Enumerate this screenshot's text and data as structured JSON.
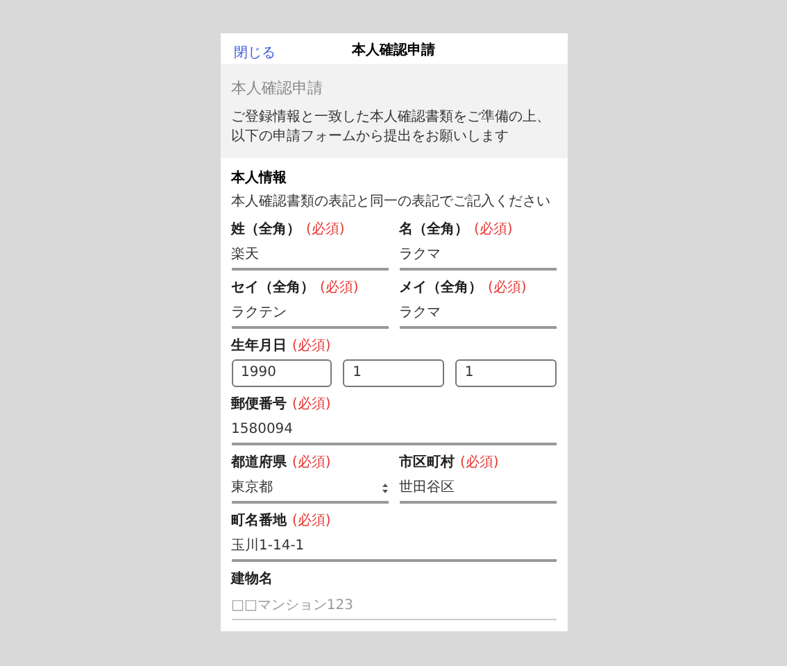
{
  "header": {
    "close": "閉じる",
    "title": "本人確認申請"
  },
  "intro": {
    "heading": "本人確認申請",
    "text": "ご登録情報と一致した本人確認書類をご準備の上、以下の申請フォームから提出をお願いします"
  },
  "section": {
    "title": "本人情報",
    "note": "本人確認書類の表記と同一の表記でご記入ください"
  },
  "rows": [
    {
      "groups": [
        {
          "label": "姓（全角）",
          "badge": "(必須)",
          "fields": [
            {
              "kind": "line",
              "value": "楽天"
            }
          ]
        },
        {
          "label": "名（全角）",
          "badge": "(必須)",
          "fields": [
            {
              "kind": "line",
              "value": "ラクマ"
            }
          ]
        }
      ]
    },
    {
      "groups": [
        {
          "label": "セイ（全角）",
          "badge": "(必須)",
          "fields": [
            {
              "kind": "line",
              "value": "ラクテン"
            }
          ]
        },
        {
          "label": "メイ（全角）",
          "badge": "(必須)",
          "fields": [
            {
              "kind": "line",
              "value": "ラクマ"
            }
          ]
        }
      ]
    },
    {
      "groups": [
        {
          "label": "生年月日",
          "badge": "(必須)",
          "fields": [
            {
              "kind": "box",
              "value": "1990"
            },
            {
              "kind": "box",
              "value": "1"
            },
            {
              "kind": "box",
              "value": "1"
            }
          ]
        }
      ]
    },
    {
      "groups": [
        {
          "label": "郵便番号",
          "badge": "(必須)",
          "fields": [
            {
              "kind": "line",
              "value": "1580094"
            }
          ]
        }
      ]
    },
    {
      "groups": [
        {
          "label": "都道府県",
          "badge": "(必須)",
          "fields": [
            {
              "kind": "select",
              "value": "東京都"
            }
          ]
        },
        {
          "label": "市区町村",
          "badge": "(必須)",
          "fields": [
            {
              "kind": "line",
              "value": "世田谷区"
            }
          ]
        }
      ]
    },
    {
      "groups": [
        {
          "label": "町名番地",
          "badge": "(必須)",
          "fields": [
            {
              "kind": "line",
              "value": "玉川1-14-1"
            }
          ]
        }
      ]
    },
    {
      "groups": [
        {
          "label": "建物名",
          "fields": [
            {
              "kind": "line",
              "placeholder": "□□マンション123"
            }
          ]
        }
      ]
    }
  ]
}
